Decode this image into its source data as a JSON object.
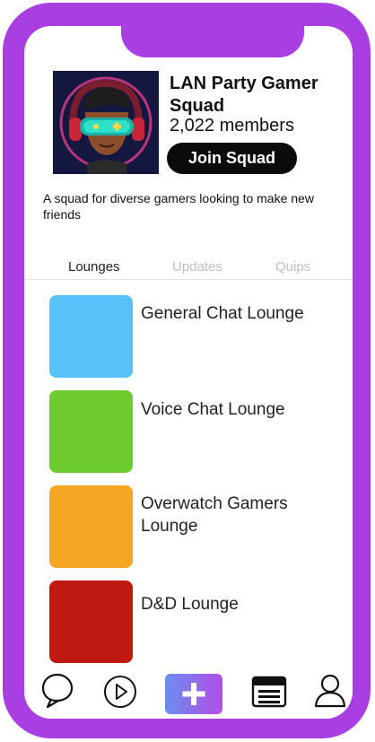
{
  "squad": {
    "title": "LAN Party Gamer Squad",
    "members": "2,022 members",
    "join_label": "Join Squad",
    "description": "A squad for diverse gamers looking to make new friends"
  },
  "tabs": [
    {
      "label": "Lounges",
      "active": true
    },
    {
      "label": "Updates",
      "active": false
    },
    {
      "label": "Quips",
      "active": false
    }
  ],
  "lounges": [
    {
      "name": "General Chat Lounge",
      "color": "#56c2f7"
    },
    {
      "name": "Voice Chat Lounge",
      "color": "#6dcb2f"
    },
    {
      "name": "Overwatch Gamers Lounge",
      "color": "#f5a623"
    },
    {
      "name": "D&D Lounge",
      "color": "#c0190f"
    }
  ],
  "bottom_nav": [
    {
      "icon": "chat-bubble-icon"
    },
    {
      "icon": "play-icon"
    },
    {
      "icon": "plus-icon"
    },
    {
      "icon": "browser-window-icon"
    },
    {
      "icon": "user-icon"
    }
  ],
  "colors": {
    "frame": "#a93ee3",
    "avatar_bg": "#14173f",
    "join_bg": "#0b0b0b",
    "tab_inactive": "#bfbfbf"
  }
}
